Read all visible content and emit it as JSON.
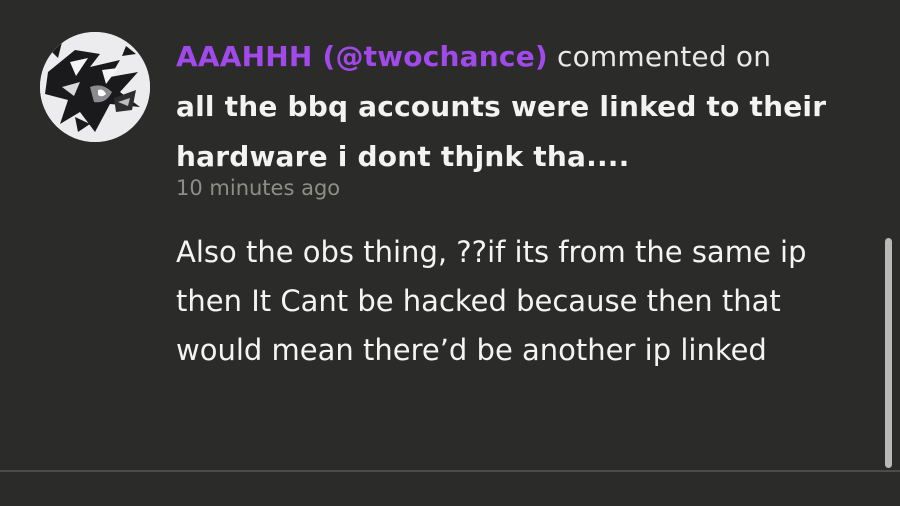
{
  "notification": {
    "username": "AAAHHH (@twochance)",
    "action": "commented on",
    "post_title": "all the bbq accounts were linked to their hardware i dont thjnk tha....",
    "timestamp": "10 minutes ago",
    "comment": "Also the obs thing, ??if its from the same ip then It Cant be hacked because then that would mean there’d be another ip linked"
  },
  "colors": {
    "background": "#2b2c29",
    "username": "#a249ec",
    "primary_text": "#f1f1ef",
    "secondary_text": "#8d8e89",
    "divider": "#4c4d49",
    "scrollbar": "#b9b9b7"
  },
  "icons": {
    "avatar": "user-avatar-drawing"
  }
}
